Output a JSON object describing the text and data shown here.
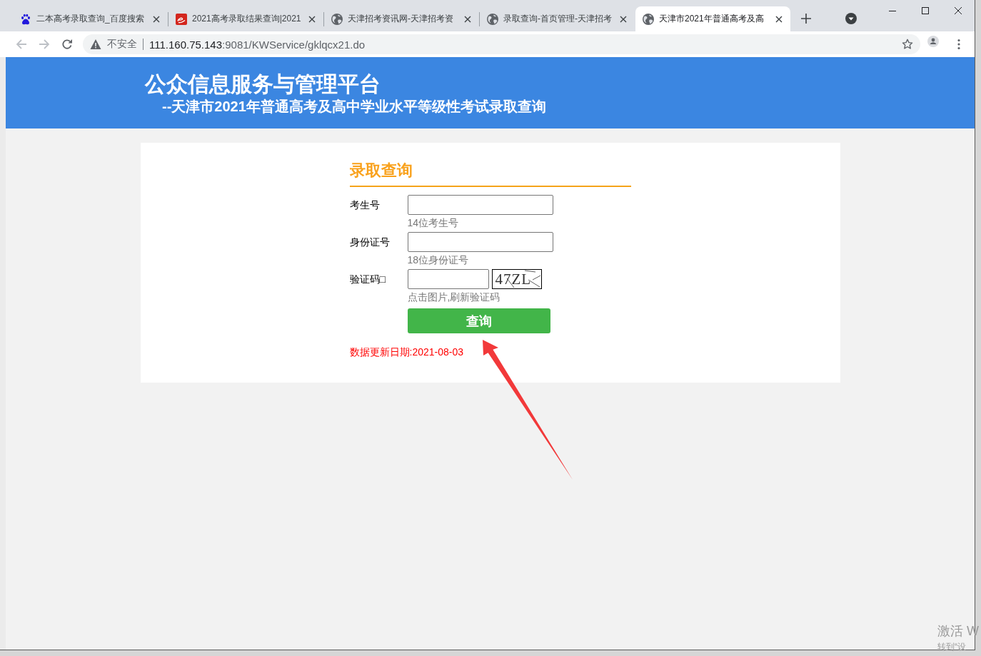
{
  "browser": {
    "tabs": [
      {
        "kind": "paw",
        "title": "二本高考录取查询_百度搜索",
        "selected": false
      },
      {
        "kind": "logo",
        "title": "2021高考录取结果查询|2021",
        "selected": false
      },
      {
        "kind": "globe",
        "title": "天津招考资讯网-天津招考资",
        "selected": false
      },
      {
        "kind": "globe",
        "title": "录取查询-首页管理-天津招考",
        "selected": false
      },
      {
        "kind": "globe",
        "title": "天津市2021年普通高考及高",
        "selected": true
      }
    ],
    "toolbar": {
      "back_disabled": true,
      "forward_disabled": true
    },
    "address_bar": {
      "security_label": "不安全",
      "url_host": "111.160.75.143",
      "url_path": ":9081/KWService/gklqcx21.do"
    }
  },
  "header": {
    "title": "公众信息服务与管理平台",
    "subtitle": "--天津市2021年普通高考及高中学业水平等级性考试录取查询"
  },
  "form": {
    "title": "录取查询",
    "fields": [
      {
        "kind": "text",
        "label": "考生号",
        "hint": "14位考生号"
      },
      {
        "kind": "text",
        "label": "身份证号",
        "hint": "18位身份证号"
      },
      {
        "kind": "captcha",
        "label": "验证码□",
        "hint": "点击图片,刷新验证码",
        "captcha_text": "47ZL"
      }
    ],
    "submit": "查询",
    "update_note": "数据更新日期:2021-08-03"
  },
  "os_notice": {
    "line_1": "激活 W",
    "line_2": "转到“设"
  }
}
